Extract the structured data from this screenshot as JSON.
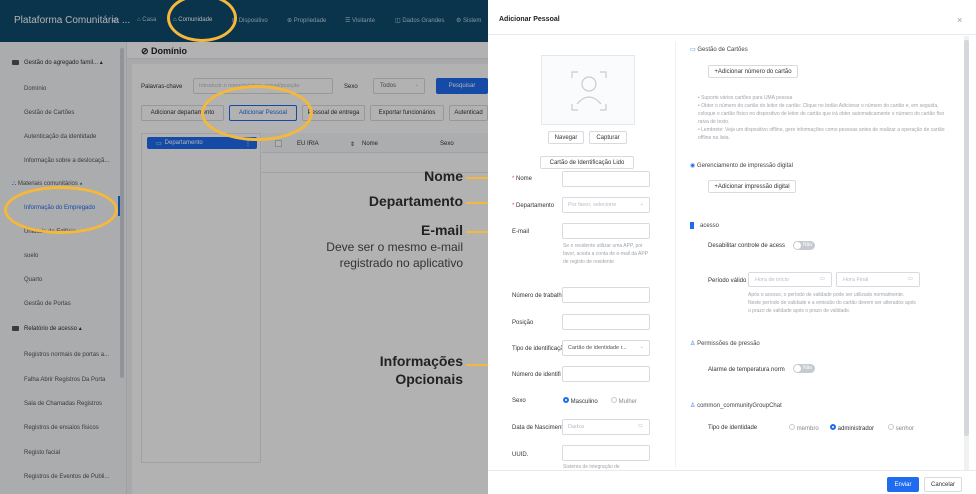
{
  "app": {
    "title": "Plataforma Comunitária ..."
  },
  "nav": [
    {
      "label": "Casa",
      "active": false
    },
    {
      "label": "Comunidade",
      "active": true
    },
    {
      "label": "Dispositivo",
      "active": false
    },
    {
      "label": "Propriedade",
      "active": false
    },
    {
      "label": "Visitante",
      "active": false
    },
    {
      "label": "Dados Grandes",
      "active": false
    },
    {
      "label": "Sistem",
      "active": false
    }
  ],
  "sidebar": {
    "group1": "Gestão do agregado famil...",
    "items1": [
      "Domínio",
      "Gestão de Cartões",
      "Autenticação da identidade",
      "Informação sobre a deslocaçã..."
    ],
    "group2": "Materiais comunitários",
    "items2": [
      "Informação do Empregado",
      "Unidade de Edifício",
      "suelo",
      "Quarto",
      "Gestão de Portas"
    ],
    "group3": "Relatório de acesso",
    "items3": [
      "Registros normais de portas a...",
      "Falha Abrir Registros Da Porta",
      "Sala de Chamadas Registros",
      "Registros de ensaios físicos",
      "Registo facial",
      "Registros de Eventos de Publi..."
    ]
  },
  "main": {
    "breadcrumb": "Domínio",
    "search_label": "Palavras-chave",
    "search_placeholder": "Introduzir o nome/telefone móvel/posição",
    "sex_label": "Sexo",
    "sex_value": "Todos",
    "search_button": "Pesquisar",
    "actions": [
      "Adicionar departamento",
      "Adicionar Pessoal",
      "Pessoal de entrega",
      "Exportar funcionários",
      "Autenticad"
    ],
    "tree_root": "Departamento",
    "table_headers": [
      "EU IRIA",
      "Nome",
      "Sexo"
    ]
  },
  "panel": {
    "title": "Adicionar Pessoal",
    "photo_buttons": [
      "Navegar",
      "Capturar"
    ],
    "id_card_button": "Cartão de Identificação Lido",
    "fields": {
      "name": "Nome",
      "department": "Departamento",
      "department_placeholder": "Por favor, selecione",
      "email": "E-mail",
      "email_hint": "Se o residente utilizar uma APP, por favor, aceda a conta de e-mail da APP de registo de residente",
      "work_number": "Número de trabalh",
      "position": "Posição",
      "id_type": "Tipo de identificaçã",
      "id_type_value": "Cartão de identidade r...",
      "id_number": "Número de identifi",
      "sex": "Sexo",
      "sex_options": [
        "Masculino",
        "Mulher"
      ],
      "birth_date": "Data de Nasciment",
      "birth_date_placeholder": "Dadxa",
      "uuid": "UUID.",
      "uuid_hint": "Sistema de integração de"
    },
    "right": {
      "cards_title": "Gestão de Cartões",
      "add_card": "+Adicionar número do cartão",
      "card_hints": [
        "Suporte vários cartões para UMA pessoa",
        "Obter o número do cartão do leitor de cartão: Clique no botão Adicionar o número do cartão e, em seguida, coloque o cartão físico no dispositivo de leitor de cartão que irá obter automaticamente o número do cartão fixo raiva de texto.",
        "Lembrete: Veja um dispositivo offline, gere informações como pessoas antes de realizar a operação de cartão offline na lista."
      ],
      "fingerprint_title": "Gerenciamento de impressão digital",
      "add_fingerprint": "+Adicionar impressão digital",
      "access_title": "acesso",
      "disable_access": "Desabilitar controle de acess",
      "toggle_no": "Não",
      "validity_label": "Período válido",
      "start_placeholder": "Hora de início",
      "end_placeholder": "Hora Final",
      "validity_hint": "Após o acesso, o período de validade pode ser utilizado normalmente. Neste período de validade e a emissão do cartão devem ser alterados após o prazo de validade após o prazo de validade.",
      "pressure_title": "Permissões de pressão",
      "temp_alarm": "Alarme de temperatura norm",
      "group_title": "common_communityGroupChat",
      "identity_type": "Tipo de identidade",
      "identity_options": [
        "membro",
        "administrador",
        "senhor"
      ]
    },
    "send": "Enviar",
    "cancel": "Cancelar"
  },
  "annotations": {
    "name": "Nome",
    "department": "Departamento",
    "email": "E-mail",
    "email_note1": "Deve ser o mesmo e-mail",
    "email_note2": "registrado no aplicativo",
    "optional1": "Informações",
    "optional2": "Opcionais"
  },
  "colors": {
    "topbar": "#0f4a6e",
    "primary": "#1f6cf0",
    "highlight": "#f5b83a"
  }
}
